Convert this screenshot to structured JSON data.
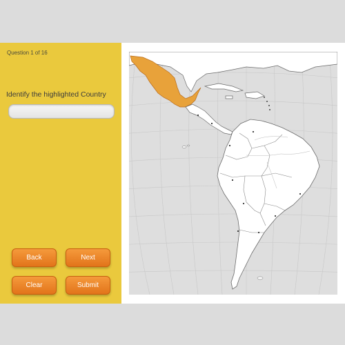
{
  "quiz": {
    "counter": "Question 1 of 16",
    "prompt": "Identify the highlighted Country",
    "answer_value": "",
    "answer_placeholder": ""
  },
  "buttons": {
    "back": "Back",
    "next": "Next",
    "clear": "Clear",
    "submit": "Submit"
  },
  "map": {
    "highlighted_country_color": "#e8a23a",
    "land_color": "#ffffff",
    "ocean_color": "#dedede",
    "grid": true
  },
  "colors": {
    "panel": "#eac93d",
    "button": "#ee8a2c",
    "background": "#dcdcdc"
  }
}
